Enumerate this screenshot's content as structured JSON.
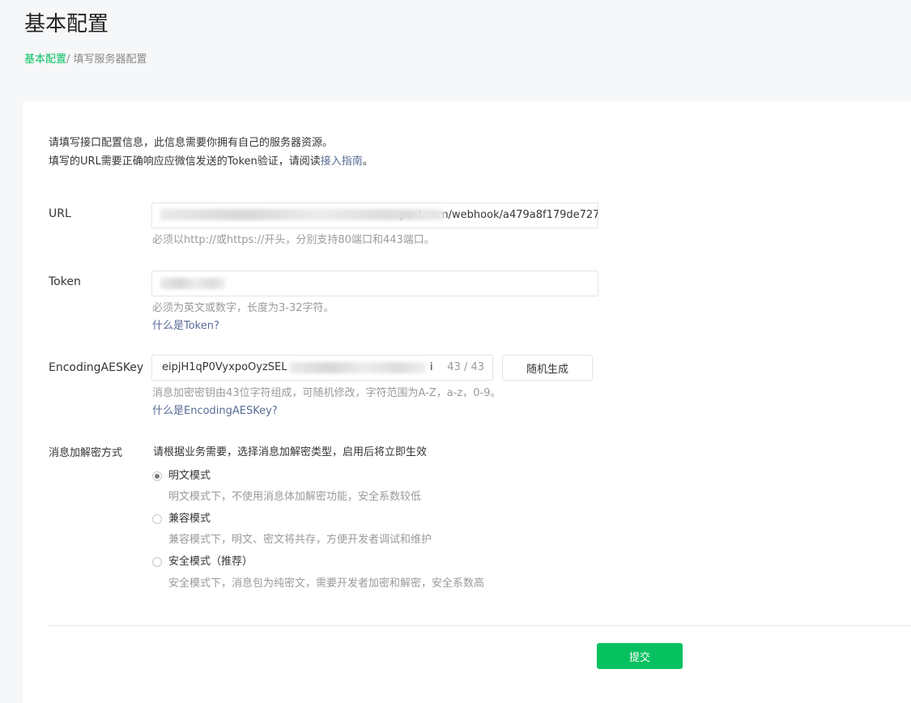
{
  "header": {
    "title": "基本配置"
  },
  "breadcrumb": {
    "parent": "基本配置",
    "separator": "/ ",
    "current": "填写服务器配置"
  },
  "intro": {
    "line1": "请填写接口配置信息，此信息需要你拥有自己的服务器资源。",
    "line2_prefix": "填写的URL需要正确响应应微信发送的Token验证，请阅读",
    "line2_link": "接入指南",
    "line2_suffix": "。"
  },
  "url_field": {
    "label": "URL",
    "value_visible": "xpost.com/webhook/a479a8f179de727",
    "hint": "必须以http://或https://开头，分别支持80端口和443端口。"
  },
  "token_field": {
    "label": "Token",
    "hint": "必须为英文或数字，长度为3-32字符。",
    "help_link": "什么是Token?"
  },
  "aes_field": {
    "label": "EncodingAESKey",
    "value_visible": "eipjH1qP0VyxpoOyzSEL",
    "value_tail": "i",
    "counter": "43 / 43",
    "generate_button": "随机生成",
    "hint": "消息加密密钥由43位字符组成，可随机修改，字符范围为A-Z，a-z，0-9。",
    "help_link": "什么是EncodingAESKey?"
  },
  "encryption": {
    "label": "消息加解密方式",
    "prompt": "请根据业务需要，选择消息加解密类型，启用后将立即生效",
    "selected_index": 0,
    "options": [
      {
        "label": "明文模式",
        "description": "明文模式下，不使用消息体加解密功能，安全系数较低"
      },
      {
        "label": "兼容模式",
        "description": "兼容模式下，明文、密文将共存，方便开发者调试和维护"
      },
      {
        "label": "安全模式（推荐）",
        "description": "安全模式下，消息包为纯密文，需要开发者加密和解密，安全系数高"
      }
    ]
  },
  "footer": {
    "submit_button": "提交"
  },
  "colors": {
    "brand_green": "#07c160",
    "link_blue": "#576b95"
  }
}
